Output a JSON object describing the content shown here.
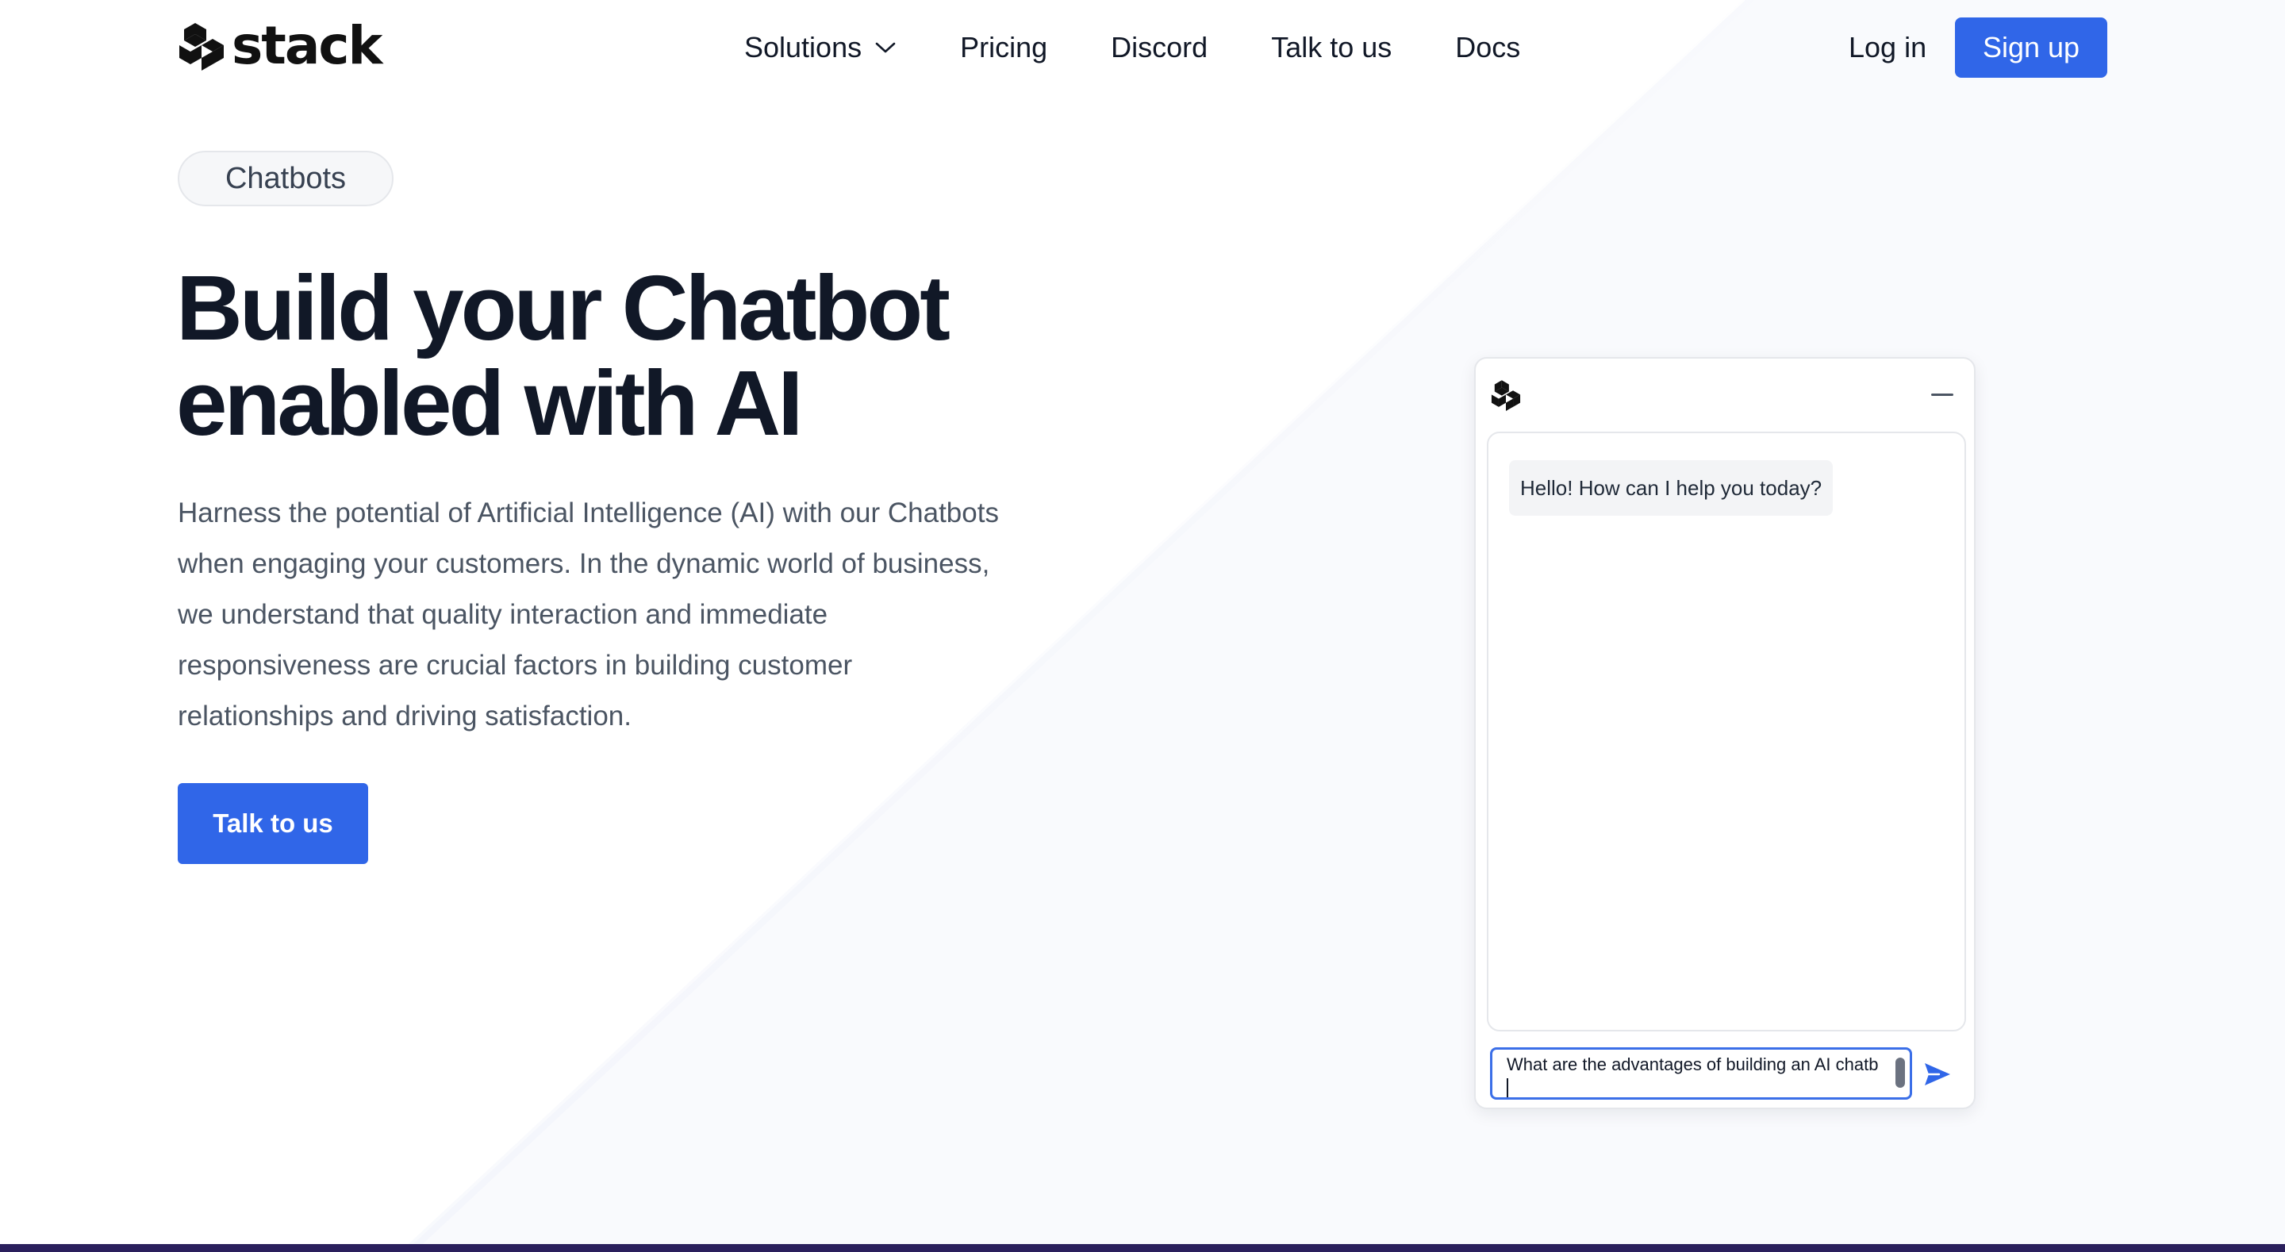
{
  "brand": {
    "name": "stack",
    "accent_color": "#3066e8"
  },
  "nav": {
    "items": [
      {
        "label": "Solutions",
        "icon": "chevron-down-icon"
      },
      {
        "label": "Pricing"
      },
      {
        "label": "Discord"
      },
      {
        "label": "Talk to us"
      },
      {
        "label": "Docs"
      }
    ],
    "login_label": "Log in",
    "signup_label": "Sign up"
  },
  "hero": {
    "tag": "Chatbots",
    "title_line1": "Build your Chatbot",
    "title_line2": "enabled with AI",
    "description": "Harness the potential of Artificial Intelligence (AI) with our Chatbots when engaging your customers. In the dynamic world of business, we understand that quality interaction and immediate responsiveness are crucial factors in building customer relationships and driving satisfaction.",
    "cta_label": "Talk to us"
  },
  "chat_widget": {
    "logo_icon": "stack-logo-icon",
    "minimize_icon": "minimize-icon",
    "messages": [
      {
        "role": "assistant",
        "text": "Hello! How can I help you today?"
      }
    ],
    "input_value": "What are the advantages of building an AI chatb",
    "send_icon": "send-icon"
  }
}
